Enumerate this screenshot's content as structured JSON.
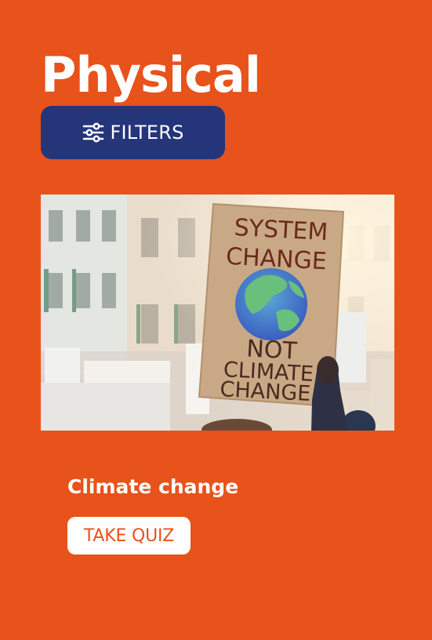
{
  "header": {
    "title": "Physical"
  },
  "filters": {
    "label": "FILTERS",
    "icon": "sliders-icon"
  },
  "card": {
    "image": {
      "description_icon": "protest-photo",
      "sign_text": [
        "SYSTEM",
        "CHANGE",
        "NOT",
        "CLIMATE",
        "CHANGE"
      ]
    },
    "title": "Climate change",
    "button_label": "TAKE QUIZ"
  },
  "colors": {
    "background": "#E8521B",
    "filters_button": "#24357A",
    "quiz_button_bg": "#FFFFFF",
    "quiz_button_text": "#E8521B"
  }
}
